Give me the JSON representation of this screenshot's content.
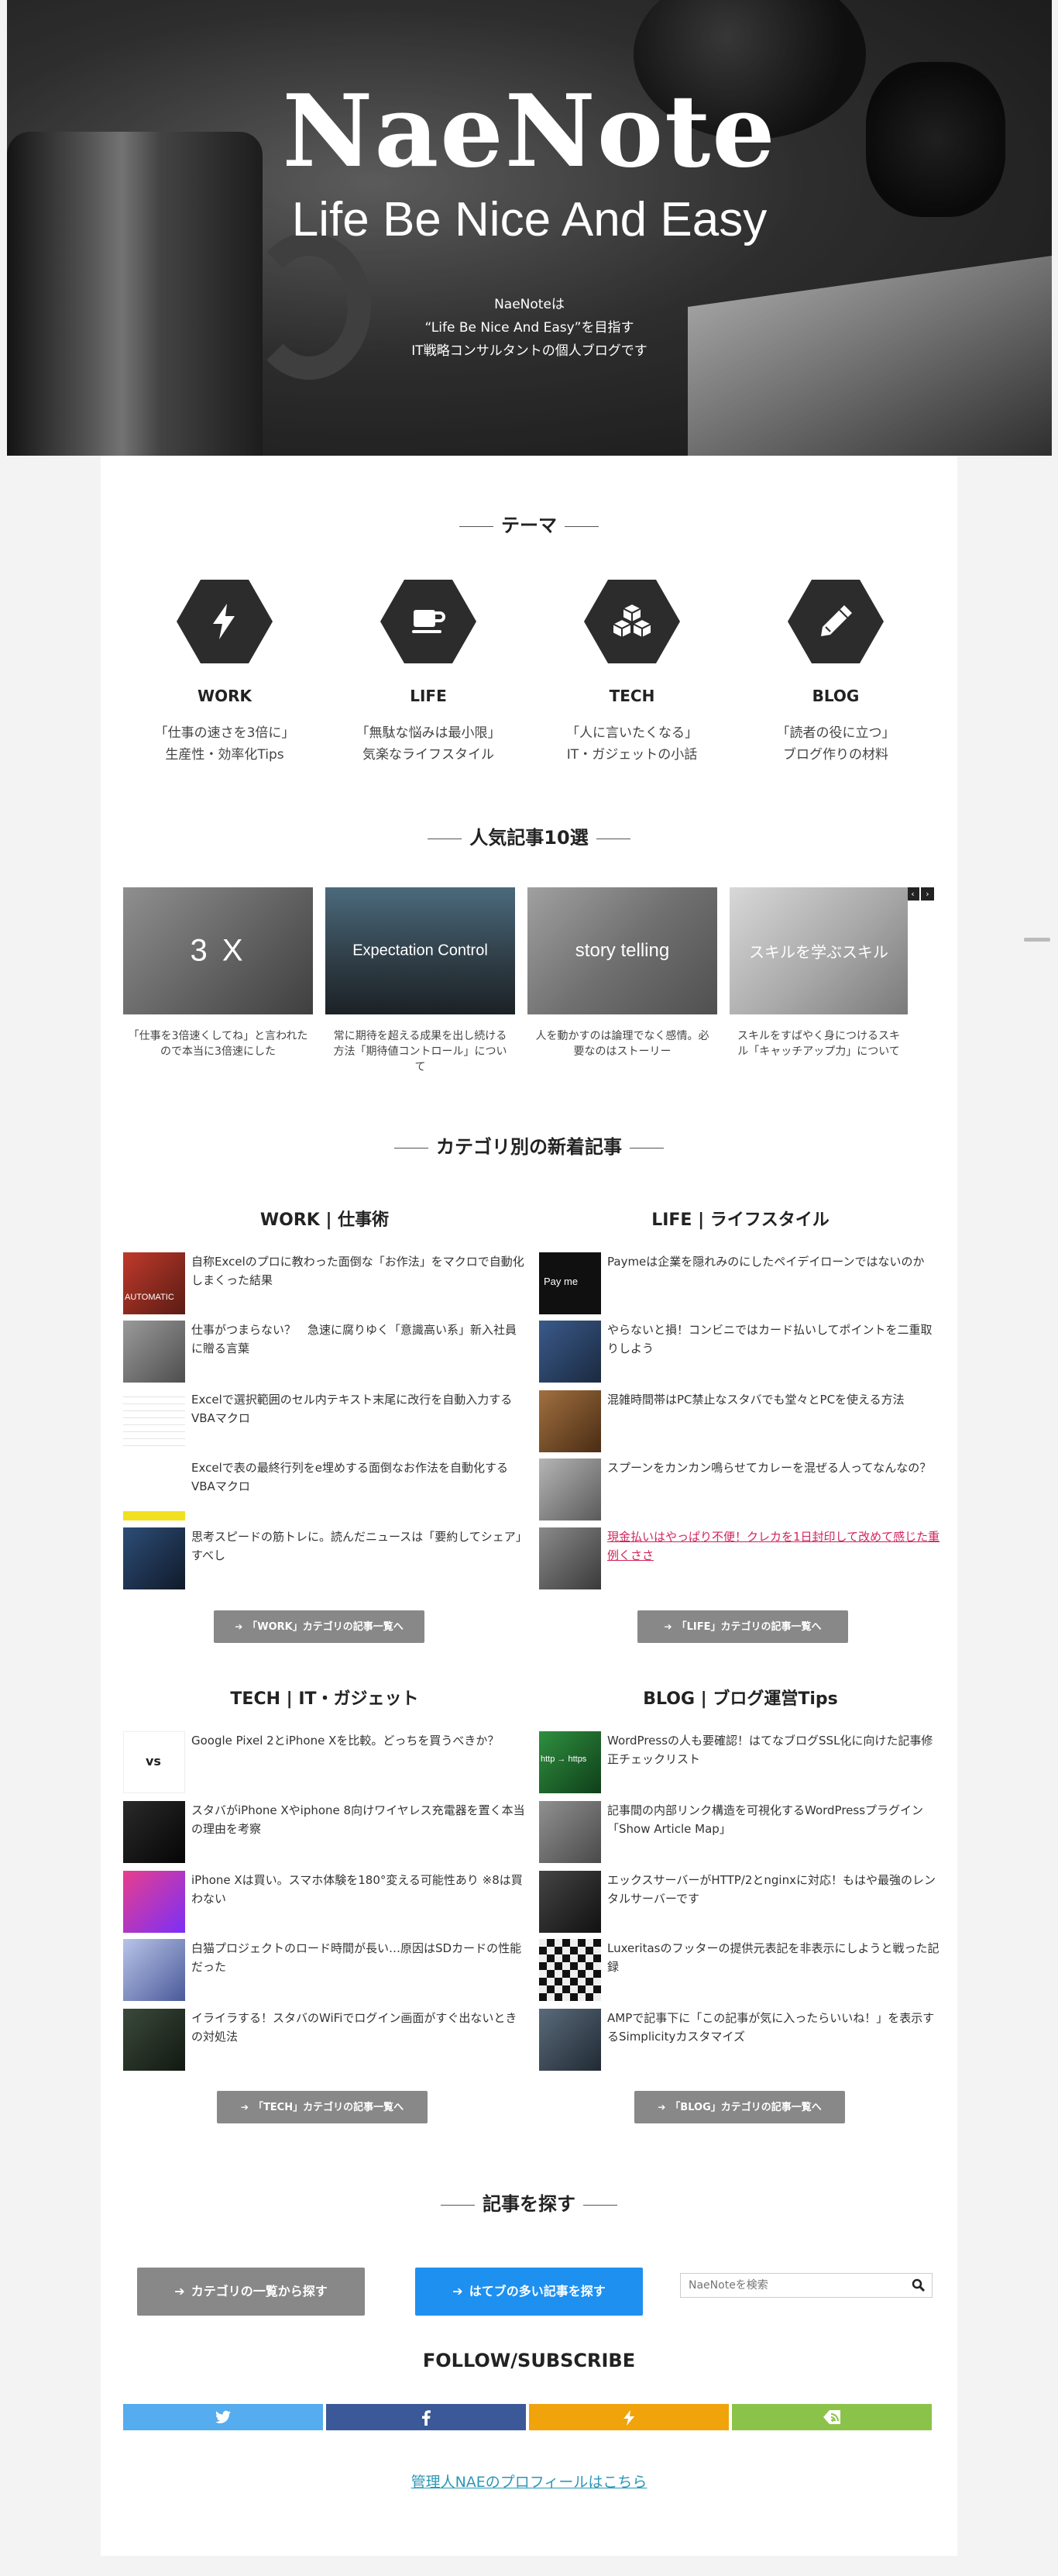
{
  "hero": {
    "title": "NaeNote",
    "subtitle": "Life Be Nice And Easy",
    "desc_line1": "NaeNoteは",
    "desc_line2": "“Life Be Nice And Easy”を目指す",
    "desc_line3": "IT戦略コンサルタントの個人ブログです"
  },
  "theme_section": {
    "heading": "テーマ",
    "items": [
      {
        "icon": "lightning-icon",
        "name": "WORK",
        "line1": "「仕事の速さを3倍に」",
        "line2": "生産性・効率化Tips"
      },
      {
        "icon": "coffee-cup-icon",
        "name": "LIFE",
        "line1": "「無駄な悩みは最小限」",
        "line2": "気楽なライフスタイル"
      },
      {
        "icon": "cubes-icon",
        "name": "TECH",
        "line1": "「人に言いたくなる」",
        "line2": "IT・ガジェットの小話"
      },
      {
        "icon": "pencil-icon",
        "name": "BLOG",
        "line1": "「読者の役に立つ」",
        "line2": "ブログ作りの材料"
      }
    ]
  },
  "popular": {
    "heading": "人気記事10選",
    "prev_label": "‹",
    "next_label": "›",
    "items": [
      {
        "overlay": "3 X",
        "caption": "「仕事を3倍速くしてね」と言われたので本当に3倍速にした"
      },
      {
        "overlay": "Expectation Control",
        "caption": "常に期待を超える成果を出し続ける方法「期待値コントロール」について"
      },
      {
        "overlay": "story telling",
        "caption": "人を動かすのは論理でなく感情。必要なのはストーリー"
      },
      {
        "overlay": "スキルを学ぶスキル",
        "caption": "スキルをすばやく身につけるスキル「キャッチアップ力」について"
      }
    ]
  },
  "categories": {
    "heading": "カテゴリ別の新着記事",
    "work": {
      "title": "WORK | 仕事術",
      "button": "「WORK」カテゴリの記事一覧へ",
      "items": [
        {
          "thumb": "AUTOMATIC",
          "text": "自称Excelのプロに教わった面倒な「お作法」をマクロで自動化しまくった結果"
        },
        {
          "thumb": "",
          "text": "仕事がつまらない？　急速に腐りゆく「意識高い系」新入社員に贈る言葉"
        },
        {
          "thumb": "",
          "text": "Excelで選択範囲のセル内テキスト末尾に改行を自動入力するVBAマクロ"
        },
        {
          "thumb": "",
          "text": "Excelで表の最終行列をe埋めする面倒なお作法を自動化するVBAマクロ"
        },
        {
          "thumb": "",
          "text": "思考スピードの筋トレに。読んだニュースは「要約してシェア」すべし"
        }
      ]
    },
    "life": {
      "title": "LIFE | ライフスタイル",
      "button": "「LIFE」カテゴリの記事一覧へ",
      "items": [
        {
          "thumb": "Pay me",
          "text": "Paymeは企業を隠れみのにしたペイデイローンではないのか"
        },
        {
          "thumb": "",
          "text": "やらないと損！コンビニではカード払いしてポイントを二重取りしよう"
        },
        {
          "thumb": "",
          "text": "混雑時間帯はPC禁止なスタバでも堂々とPCを使える方法"
        },
        {
          "thumb": "",
          "text": "スプーンをカンカン鳴らせてカレーを混ぜる人ってなんなの？"
        },
        {
          "thumb": "",
          "text": "現金払いはやっぱり不便！クレカを1日封印して改めて感じた重例くささ"
        }
      ]
    },
    "tech": {
      "title": "TECH | IT・ガジェット",
      "button": "「TECH」カテゴリの記事一覧へ",
      "items": [
        {
          "thumb": "vs",
          "text": "Google Pixel 2とiPhone Xを比較。どっちを買うべきか？"
        },
        {
          "thumb": "",
          "text": "スタバがiPhone Xやiphone 8向けワイヤレス充電器を置く本当の理由を考察"
        },
        {
          "thumb": "",
          "text": "iPhone Xは買い。スマホ体験を180°変える可能性あり ※8は買わない"
        },
        {
          "thumb": "",
          "text": "白猫プロジェクトのロード時間が長い…原因はSDカードの性能だった"
        },
        {
          "thumb": "",
          "text": "イライラする！スタバのWiFiでログイン画面がすぐ出ないときの対処法"
        }
      ]
    },
    "blog": {
      "title": "BLOG | ブログ運営Tips",
      "button": "「BLOG」カテゴリの記事一覧へ",
      "items": [
        {
          "thumb": "http → https",
          "text": "WordPressの人も要確認！はてなブログSSL化に向けた記事修正チェックリスト"
        },
        {
          "thumb": "",
          "text": "記事間の内部リンク構造を可視化するWordPressプラグイン「Show Article Map」"
        },
        {
          "thumb": "",
          "text": "エックスサーバーがHTTP/2とnginxに対応！もはや最強のレンタルサーバーです"
        },
        {
          "thumb": "",
          "text": "Luxeritasのフッターの提供元表記を非表示にしようと戦った記録"
        },
        {
          "thumb": "",
          "text": "AMPで記事下に「この記事が気に入ったらいいね！」を表示するSimplicityカスタマイズ"
        }
      ]
    }
  },
  "find": {
    "heading": "記事を探す",
    "category_button": "カテゴリの一覧から探す",
    "hatena_button": "はてブの多い記事を探す",
    "search_placeholder": "NaeNoteを検索"
  },
  "follow": {
    "heading": "FOLLOW/SUBSCRIBE",
    "buttons": [
      {
        "icon": "twitter-icon",
        "color": "#55acee"
      },
      {
        "icon": "facebook-icon",
        "color": "#3b5998"
      },
      {
        "icon": "feedly-icon",
        "color": "#f0a30a"
      },
      {
        "icon": "feed-icon",
        "color": "#8bc34a"
      }
    ]
  },
  "profile_link": "管理人NAEのプロフィールはこちら",
  "colors": {
    "accent_blue": "#1e90f0",
    "button_gray": "#888888",
    "link_teal": "#2b97b7",
    "alert_link": "#d4235a"
  }
}
